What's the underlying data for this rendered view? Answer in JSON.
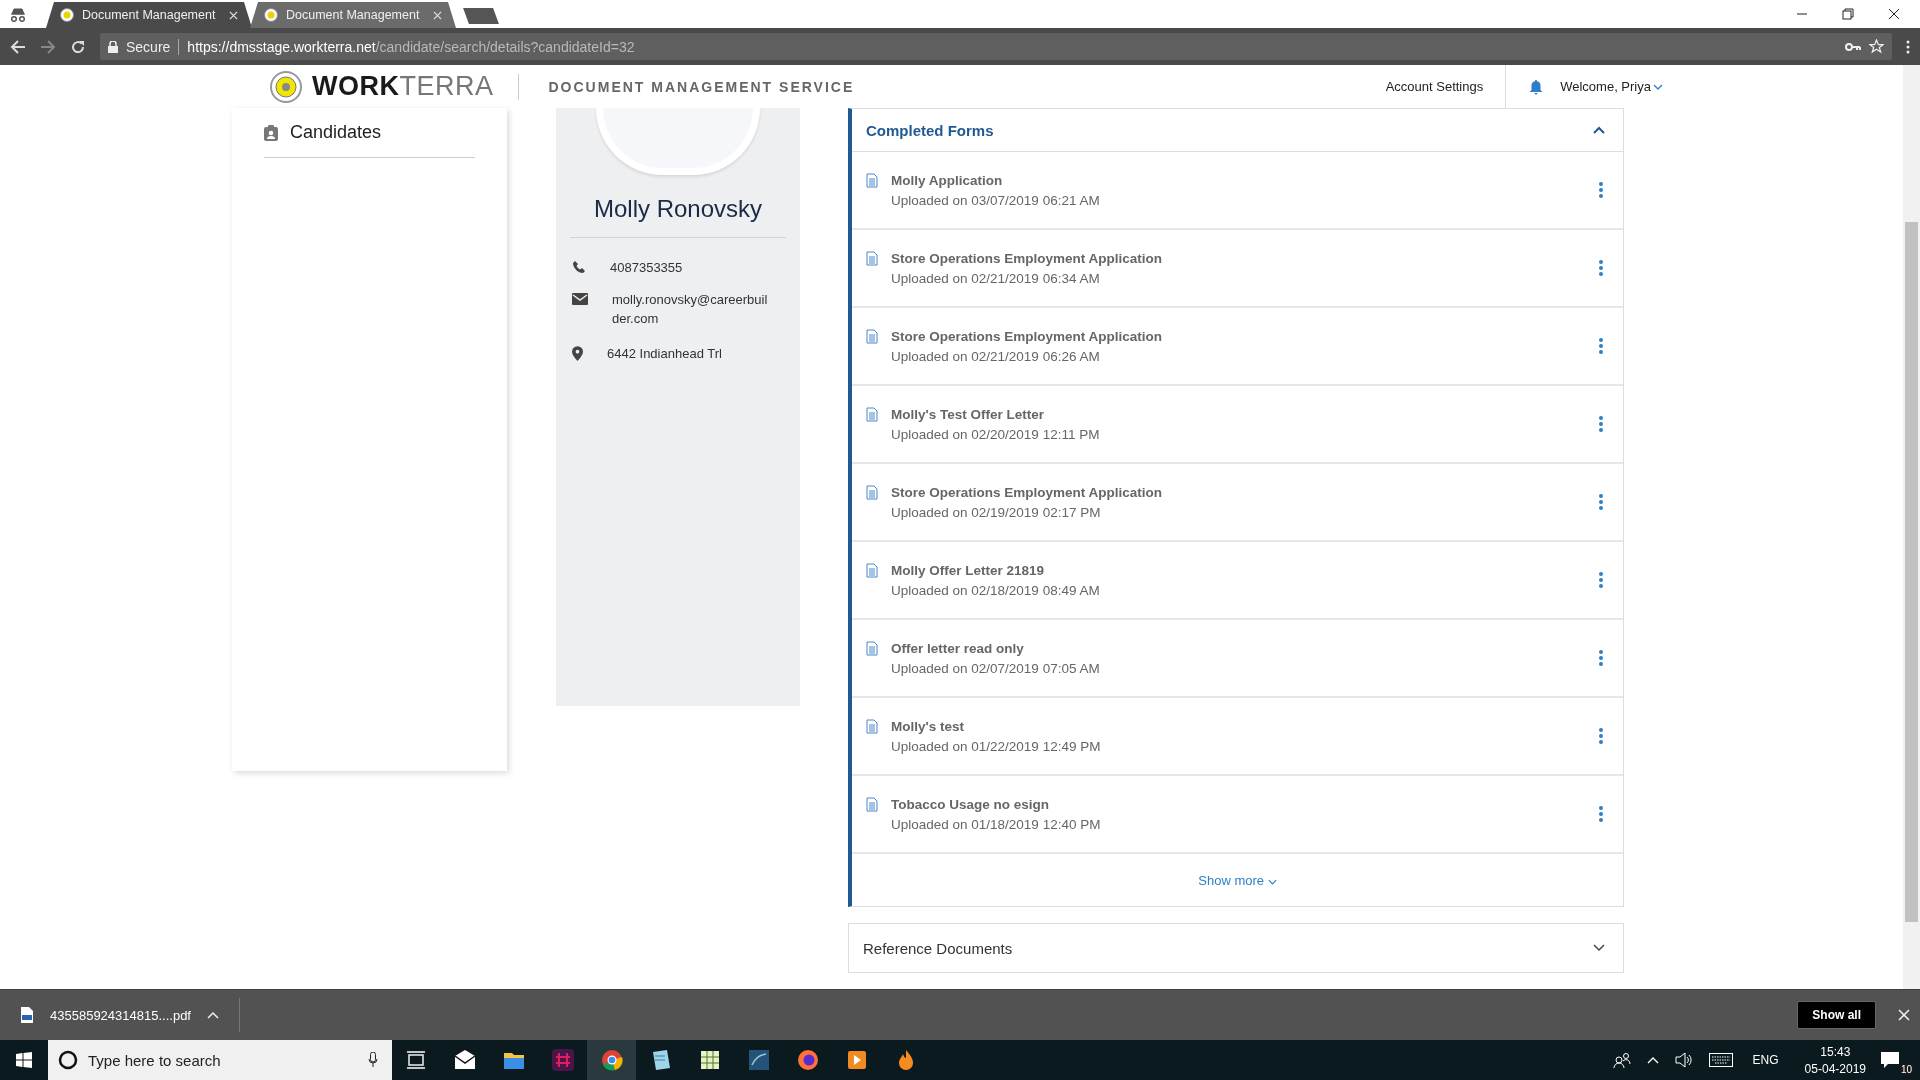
{
  "browser": {
    "tabs": [
      {
        "title": "Document Management",
        "selected": true
      },
      {
        "title": "Document Management",
        "selected": false
      }
    ],
    "address": {
      "secure": "Secure",
      "host": "https://dmsstage.workterra.net",
      "path": "/candidate/search/details?candidateId=32"
    }
  },
  "header": {
    "brand_bold": "WORK",
    "brand_light": "TERRA",
    "service": "DOCUMENT MANAGEMENT SERVICE",
    "account_settings": "Account Settings",
    "welcome": "Welcome, Priya"
  },
  "sidebar": {
    "items": [
      {
        "label": "Candidates"
      }
    ]
  },
  "profile": {
    "name": "Molly Ronovsky",
    "phone": "4087353355",
    "email": "molly.ronovsky@careerbuilder.com",
    "address": "6442 Indianhead Trl"
  },
  "completed_forms": {
    "title": "Completed Forms",
    "expanded": true,
    "items": [
      {
        "title": "Molly Application",
        "uploaded": "Uploaded on 03/07/2019 06:21 AM"
      },
      {
        "title": "Store Operations Employment Application",
        "uploaded": "Uploaded on 02/21/2019 06:34 AM"
      },
      {
        "title": "Store Operations Employment Application",
        "uploaded": "Uploaded on 02/21/2019 06:26 AM"
      },
      {
        "title": "Molly's Test Offer Letter",
        "uploaded": "Uploaded on 02/20/2019 12:11 PM"
      },
      {
        "title": "Store Operations Employment Application",
        "uploaded": "Uploaded on 02/19/2019 02:17 PM"
      },
      {
        "title": "Molly Offer Letter 21819",
        "uploaded": "Uploaded on 02/18/2019 08:49 AM"
      },
      {
        "title": "Offer letter read only",
        "uploaded": "Uploaded on 02/07/2019 07:05 AM"
      },
      {
        "title": "Molly's test",
        "uploaded": "Uploaded on 01/22/2019 12:49 PM"
      },
      {
        "title": "Tobacco Usage no esign",
        "uploaded": "Uploaded on 01/18/2019 12:40 PM"
      }
    ],
    "show_more": "Show more"
  },
  "reference_documents": {
    "title": "Reference Documents",
    "expanded": false
  },
  "downloads": {
    "file": "435585924314815....pdf",
    "show_all": "Show all"
  },
  "taskbar": {
    "search_placeholder": "Type here to search",
    "language": "ENG",
    "time": "15:43",
    "date": "05-04-2019",
    "notifications": "10"
  }
}
